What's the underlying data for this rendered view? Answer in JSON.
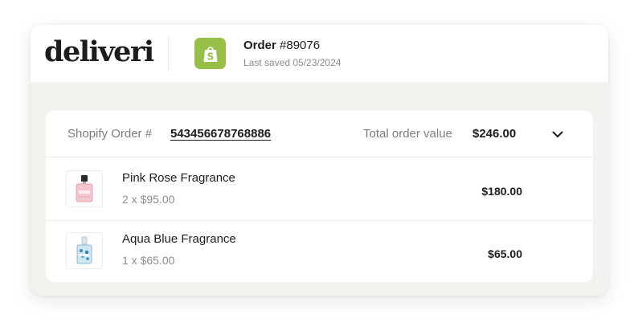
{
  "brand": {
    "logo_text": "deliveri"
  },
  "order": {
    "label": "Order",
    "number": "#89076",
    "last_saved": "Last saved 05/23/2024",
    "platform_icon": "shopify-bag-icon",
    "platform_color": "#95bf47"
  },
  "summary": {
    "shopify_label": "Shopify Order #",
    "shopify_number": "543456678768886",
    "total_label": "Total order value",
    "total_value": "$246.00",
    "toggle_icon": "chevron-down-icon"
  },
  "items": [
    {
      "name": "Pink Rose Fragrance",
      "quantity": "2 x $95.00",
      "price": "$180.00",
      "image": "pink-perfume-bottle-icon"
    },
    {
      "name": "Aqua Blue Fragrance",
      "quantity": "1 x $65.00",
      "price": "$65.00",
      "image": "blue-perfume-bottle-icon"
    }
  ]
}
